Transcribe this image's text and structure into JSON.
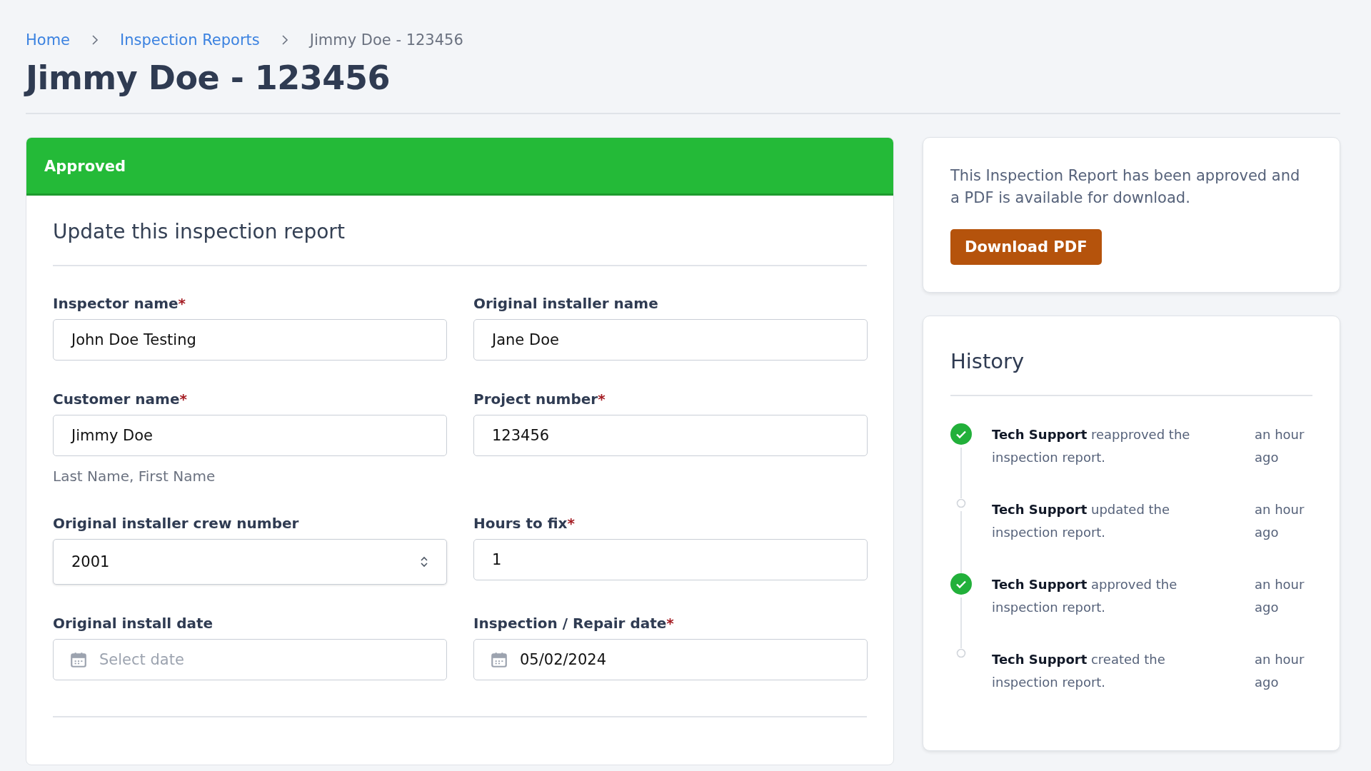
{
  "breadcrumb": [
    {
      "label": "Home",
      "kind": "link"
    },
    {
      "label": "Inspection Reports",
      "kind": "link"
    },
    {
      "label": "Jimmy Doe - 123456",
      "kind": "current"
    }
  ],
  "title": "Jimmy Doe - 123456",
  "status_banner": {
    "label": "Approved"
  },
  "form": {
    "heading": "Update this inspection report",
    "fields": [
      {
        "label": "Inspector name",
        "required_mark": "*",
        "kind": "text",
        "value": "John Doe Testing"
      },
      {
        "label": "Original installer name",
        "kind": "text",
        "value": "Jane Doe"
      },
      {
        "label": "Customer name",
        "required_mark": "*",
        "kind": "text",
        "value": "Jimmy Doe",
        "hint": "Last Name, First Name"
      },
      {
        "label": "Project number",
        "required_mark": "*",
        "kind": "text",
        "value": "123456"
      },
      {
        "label": "Original installer crew number",
        "kind": "select",
        "value": "2001"
      },
      {
        "label": "Hours to fix",
        "required_mark": "*",
        "kind": "text",
        "value": "1"
      },
      {
        "label": "Original install date",
        "kind": "date",
        "placeholder": "Select date"
      },
      {
        "label": "Inspection / Repair date",
        "required_mark": "*",
        "kind": "date",
        "value": "05/02/2024"
      }
    ]
  },
  "pdf_card": {
    "message": "This Inspection Report has been approved and a PDF is available for download.",
    "button": "Download PDF"
  },
  "history": {
    "title": "History",
    "items": [
      {
        "kind": "approved",
        "text": "**Tech Support** reapproved the inspection report.",
        "time": "an hour ago"
      },
      {
        "kind": "event",
        "text": "**Tech Support** updated the inspection report.",
        "time": "an hour ago"
      },
      {
        "kind": "approved",
        "text": "**Tech Support** approved the inspection report.",
        "time": "an hour ago"
      },
      {
        "kind": "event",
        "text": "**Tech Support** created the inspection report.",
        "time": "an hour ago"
      }
    ]
  }
}
